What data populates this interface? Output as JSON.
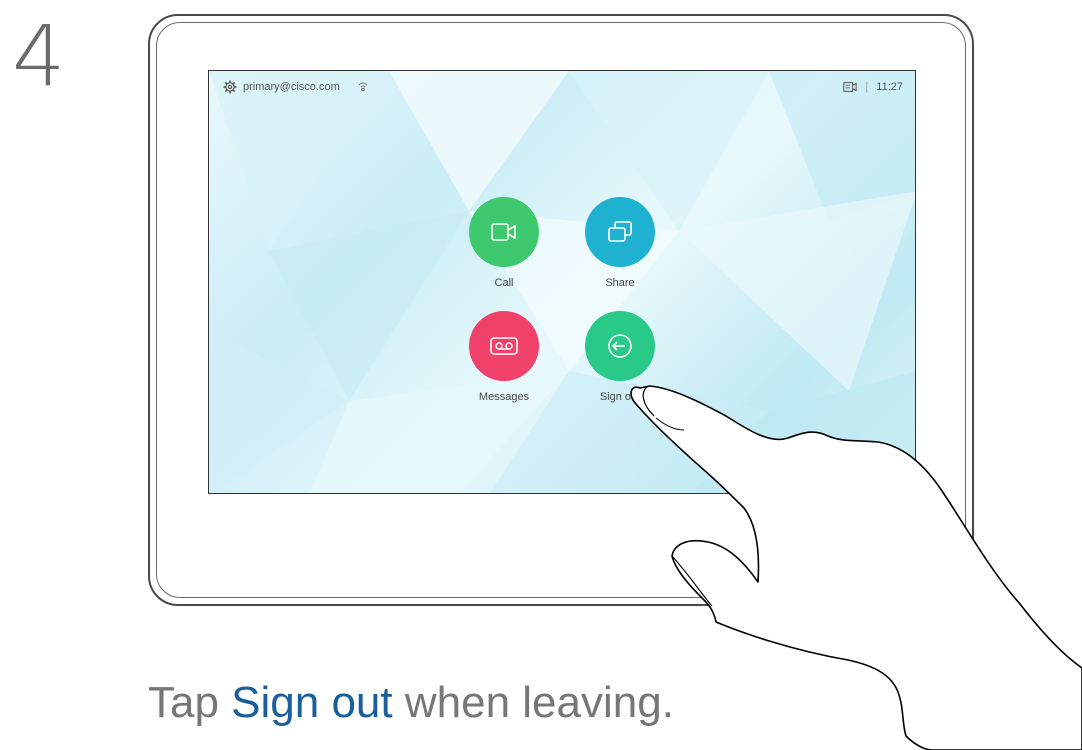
{
  "step": {
    "number": "4"
  },
  "status": {
    "account": "primary@cisco.com",
    "time": "11:27",
    "separator": "|"
  },
  "tiles": [
    {
      "label": "Call",
      "color": "#3ec96e",
      "icon": "video-camera-icon"
    },
    {
      "label": "Share",
      "color": "#1fb2d0",
      "icon": "share-screens-icon"
    },
    {
      "label": "Messages",
      "color": "#f0416a",
      "icon": "voicemail-icon"
    },
    {
      "label": "Sign out",
      "color": "#29c987",
      "icon": "sign-out-icon"
    }
  ],
  "caption": {
    "prefix": "Tap ",
    "action": "Sign out",
    "suffix": " when leaving."
  },
  "colors": {
    "caption_accent": "#1a5e9c",
    "text_gray": "#777777"
  }
}
